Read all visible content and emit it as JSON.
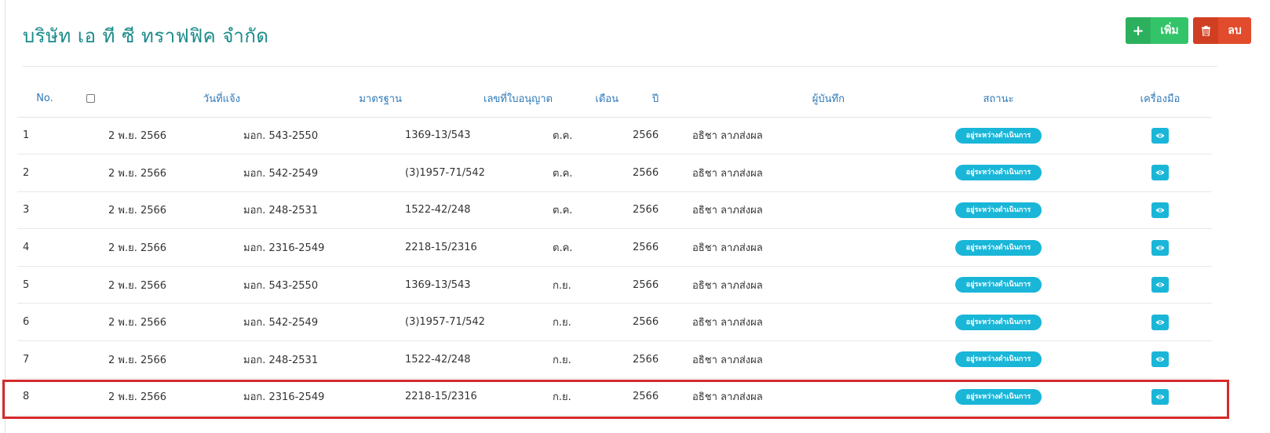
{
  "page": {
    "title": "บริษัท เอ ที ซี ทราฟฟิค จำกัด"
  },
  "toolbar": {
    "add_label": "เพิ่ม",
    "delete_label": "ลบ"
  },
  "colors": {
    "accent": "#19b6d8",
    "add": "#33c46a",
    "delete": "#e24b2b",
    "title": "#1a8a8a",
    "header": "#2f79b9"
  },
  "table": {
    "headers": {
      "no": "No.",
      "date": "วันที่แจ้ง",
      "standard": "มาตรฐาน",
      "license": "เลขที่ใบอนุญาต",
      "month": "เดือน",
      "year": "ปี",
      "recorder": "ผู้บันทึก",
      "status": "สถานะ",
      "tools": "เครื่องมือ"
    },
    "rows": [
      {
        "no": "1",
        "date": "2 พ.ย. 2566",
        "standard": "มอก. 543-2550",
        "license": "1369-13/543",
        "month": "ต.ค.",
        "year": "2566",
        "recorder": "อธิชา ลาภส่งผล",
        "status": "อยู่ระหว่างดำเนินการ"
      },
      {
        "no": "2",
        "date": "2 พ.ย. 2566",
        "standard": "มอก. 542-2549",
        "license": "(3)1957-71/542",
        "month": "ต.ค.",
        "year": "2566",
        "recorder": "อธิชา ลาภส่งผล",
        "status": "อยู่ระหว่างดำเนินการ"
      },
      {
        "no": "3",
        "date": "2 พ.ย. 2566",
        "standard": "มอก. 248-2531",
        "license": "1522-42/248",
        "month": "ต.ค.",
        "year": "2566",
        "recorder": "อธิชา ลาภส่งผล",
        "status": "อยู่ระหว่างดำเนินการ"
      },
      {
        "no": "4",
        "date": "2 พ.ย. 2566",
        "standard": "มอก. 2316-2549",
        "license": "2218-15/2316",
        "month": "ต.ค.",
        "year": "2566",
        "recorder": "อธิชา ลาภส่งผล",
        "status": "อยู่ระหว่างดำเนินการ"
      },
      {
        "no": "5",
        "date": "2 พ.ย. 2566",
        "standard": "มอก. 543-2550",
        "license": "1369-13/543",
        "month": "ก.ย.",
        "year": "2566",
        "recorder": "อธิชา ลาภส่งผล",
        "status": "อยู่ระหว่างดำเนินการ"
      },
      {
        "no": "6",
        "date": "2 พ.ย. 2566",
        "standard": "มอก. 542-2549",
        "license": "(3)1957-71/542",
        "month": "ก.ย.",
        "year": "2566",
        "recorder": "อธิชา ลาภส่งผล",
        "status": "อยู่ระหว่างดำเนินการ"
      },
      {
        "no": "7",
        "date": "2 พ.ย. 2566",
        "standard": "มอก. 248-2531",
        "license": "1522-42/248",
        "month": "ก.ย.",
        "year": "2566",
        "recorder": "อธิชา ลาภส่งผล",
        "status": "อยู่ระหว่างดำเนินการ"
      },
      {
        "no": "8",
        "date": "2 พ.ย. 2566",
        "standard": "มอก. 2316-2549",
        "license": "2218-15/2316",
        "month": "ก.ย.",
        "year": "2566",
        "recorder": "อธิชา ลาภส่งผล",
        "status": "อยู่ระหว่างดำเนินการ"
      }
    ]
  }
}
